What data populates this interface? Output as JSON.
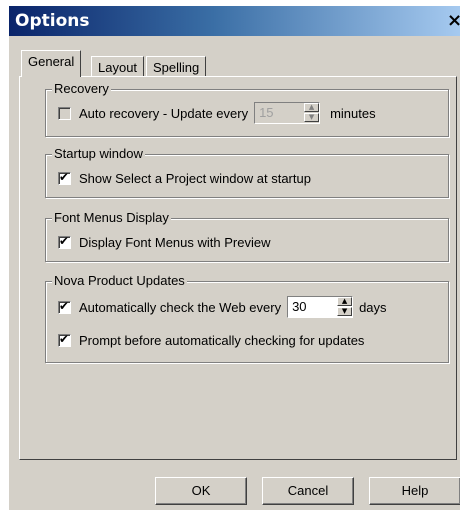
{
  "window": {
    "title": "Options",
    "close_glyph": "×"
  },
  "tabs": [
    {
      "label": "General",
      "active": true
    },
    {
      "label": "Layout",
      "active": false
    },
    {
      "label": "Spelling",
      "active": false
    }
  ],
  "groups": {
    "recovery": {
      "title": "Recovery",
      "auto_recovery_label": "Auto recovery - Update every",
      "auto_recovery_checked": false,
      "auto_recovery_enabled": false,
      "interval_value": "15",
      "interval_unit": "minutes"
    },
    "startup": {
      "title": "Startup window",
      "show_select_project_label": "Show Select a Project window at startup",
      "show_select_project_checked": true
    },
    "font_menus": {
      "title": "Font Menus Display",
      "preview_label": "Display Font Menus with Preview",
      "preview_checked": true
    },
    "updates": {
      "title": "Nova Product Updates",
      "auto_check_label": "Automatically check the Web every",
      "auto_check_checked": true,
      "check_interval_value": "30",
      "check_interval_unit": "days",
      "prompt_label": "Prompt before automatically checking for updates",
      "prompt_checked": true
    }
  },
  "buttons": {
    "ok": "OK",
    "cancel": "Cancel",
    "help": "Help"
  },
  "icons": {
    "check": "check-mark-icon",
    "spin_up": "arrow-up-icon",
    "spin_down": "arrow-down-icon",
    "close": "close-icon"
  },
  "colors": {
    "dialog_face": "#d4d0c8",
    "title_start": "#0a246a",
    "title_end": "#a6caf0"
  }
}
